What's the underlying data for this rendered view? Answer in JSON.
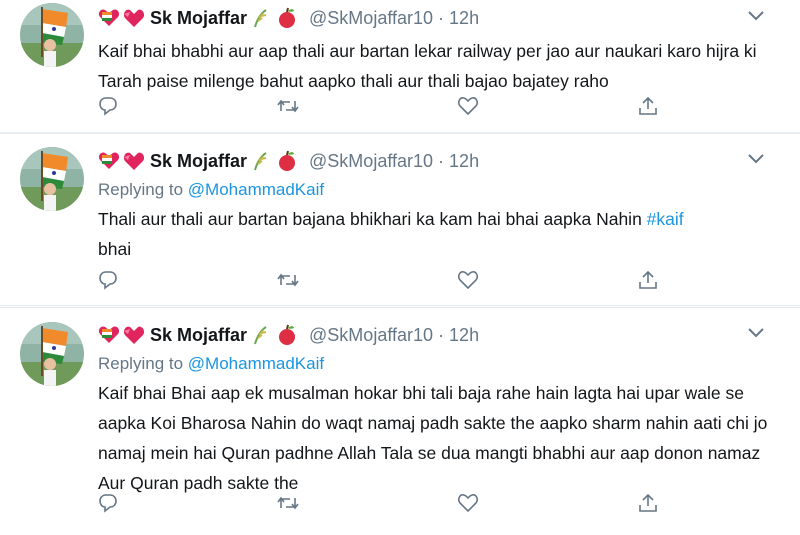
{
  "colors": {
    "link": "#1b95e0",
    "secondary_text": "#657786",
    "primary_text": "#14171a",
    "divider": "#e6ecf0"
  },
  "tweets": [
    {
      "display_name": "Sk Mojaffar",
      "handle": "@SkMojaffar10",
      "time": "· 12h",
      "reply_prefix": "",
      "reply_to": "",
      "text_main": "Kaif bhai bhabhi aur aap thali aur bartan lekar railway per jao aur naukari karo hijra ki Tarah paise milenge bahut aapko thali aur thali bajao bajatey raho",
      "hashtag": "",
      "text_after": ""
    },
    {
      "display_name": "Sk Mojaffar",
      "handle": "@SkMojaffar10",
      "time": "· 12h",
      "reply_prefix": "Replying to ",
      "reply_to": "@MohammadKaif",
      "text_main": "Thali aur thali aur bartan bajana bhikhari ka kam hai bhai aapka Nahin ",
      "hashtag": "#kaif",
      "text_after": " bhai"
    },
    {
      "display_name": "Sk Mojaffar",
      "handle": "@SkMojaffar10",
      "time": "· 12h",
      "reply_prefix": "Replying to ",
      "reply_to": "@MohammadKaif",
      "text_main": "Kaif bhai Bhai aap ek musalman hokar bhi tali baja rahe hain lagta hai upar wale se aapka Koi Bharosa Nahin do waqt namaj padh sakte the aapko sharm nahin aati chi jo namaj mein hai Quran padhne Allah Tala se dua mangti bhabhi aur aap donon namaz Aur Quran padh sakte the",
      "hashtag": "",
      "text_after": ""
    }
  ],
  "icons": {
    "reply": "reply-icon",
    "retweet": "retweet-icon",
    "like": "like-icon",
    "share": "share-icon",
    "caret": "chevron-down-icon"
  }
}
